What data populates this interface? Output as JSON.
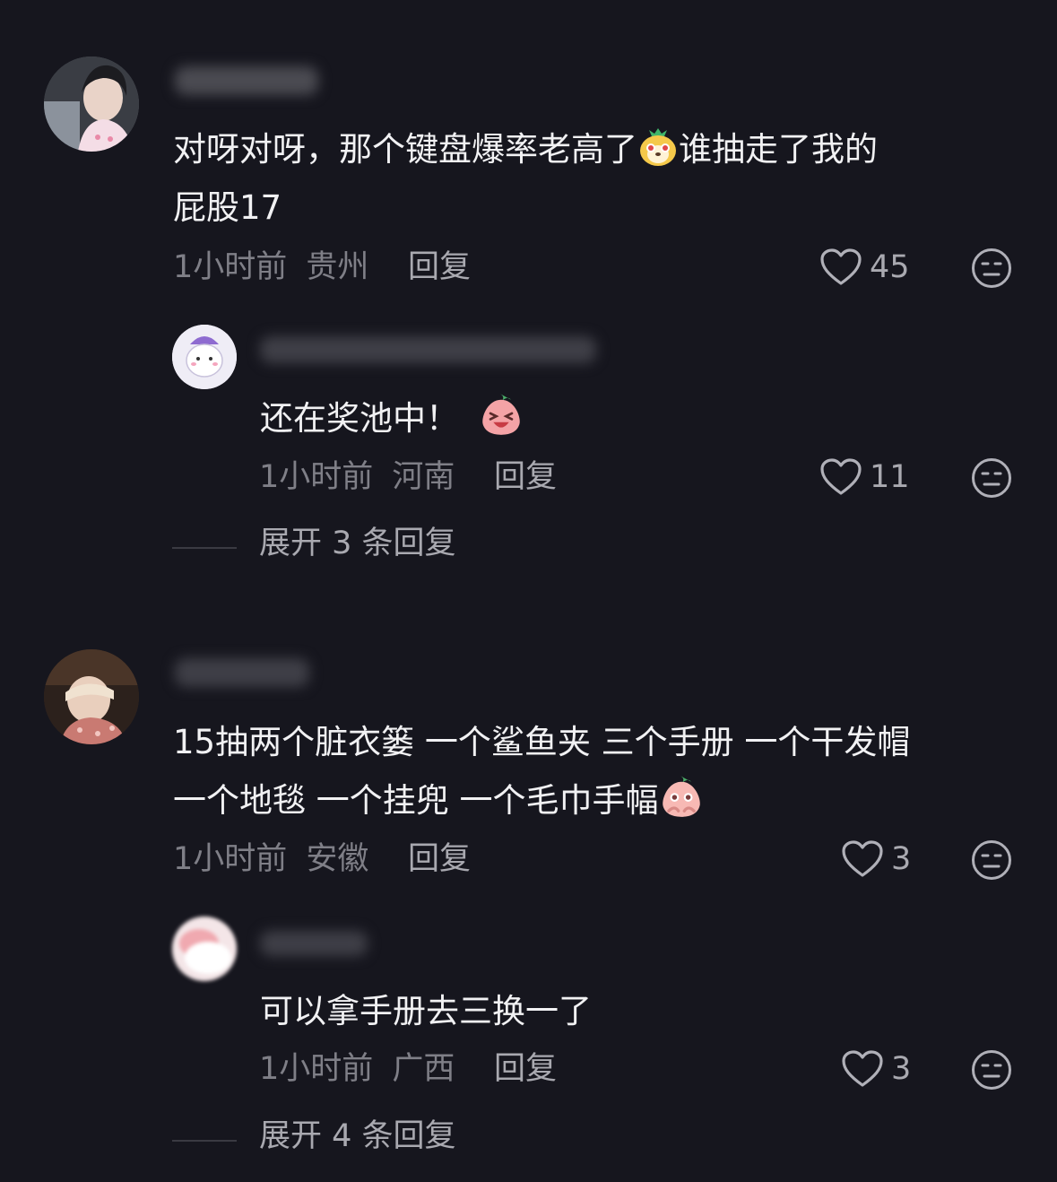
{
  "comments": [
    {
      "text_lines": [
        "对呀对呀，那个键盘爆率老高了",
        "谁抽走了我的",
        "屁股17"
      ],
      "time": "1小时前",
      "location": "贵州",
      "reply_label": "回复",
      "likes": "45",
      "emoji_names": [
        "pineapple-dog-emoji"
      ],
      "replies": [
        {
          "text": "还在奖池中！",
          "time": "1小时前",
          "location": "河南",
          "reply_label": "回复",
          "likes": "11",
          "emoji_names": [
            "laughing-peach-emoji"
          ]
        }
      ],
      "expand_label": "展开 3 条回复"
    },
    {
      "text_lines": [
        "15抽两个脏衣篓 一个鲨鱼夹 三个手册 一个干发帽",
        "一个地毯 一个挂兜 一个毛巾手幅"
      ],
      "time": "1小时前",
      "location": "安徽",
      "reply_label": "回复",
      "likes": "3",
      "emoji_names": [
        "shy-peach-emoji"
      ],
      "replies": [
        {
          "text": "可以拿手册去三换一了",
          "time": "1小时前",
          "location": "广西",
          "reply_label": "回复",
          "likes": "3"
        }
      ],
      "expand_label": "展开 4 条回复"
    }
  ],
  "icons": {
    "like": "heart-outline-icon",
    "dislike": "neutral-face-icon"
  },
  "colors": {
    "background": "#16161e",
    "text": "#f1f1f3",
    "meta": "#7f7f87",
    "secondary": "#a9a9b0"
  }
}
